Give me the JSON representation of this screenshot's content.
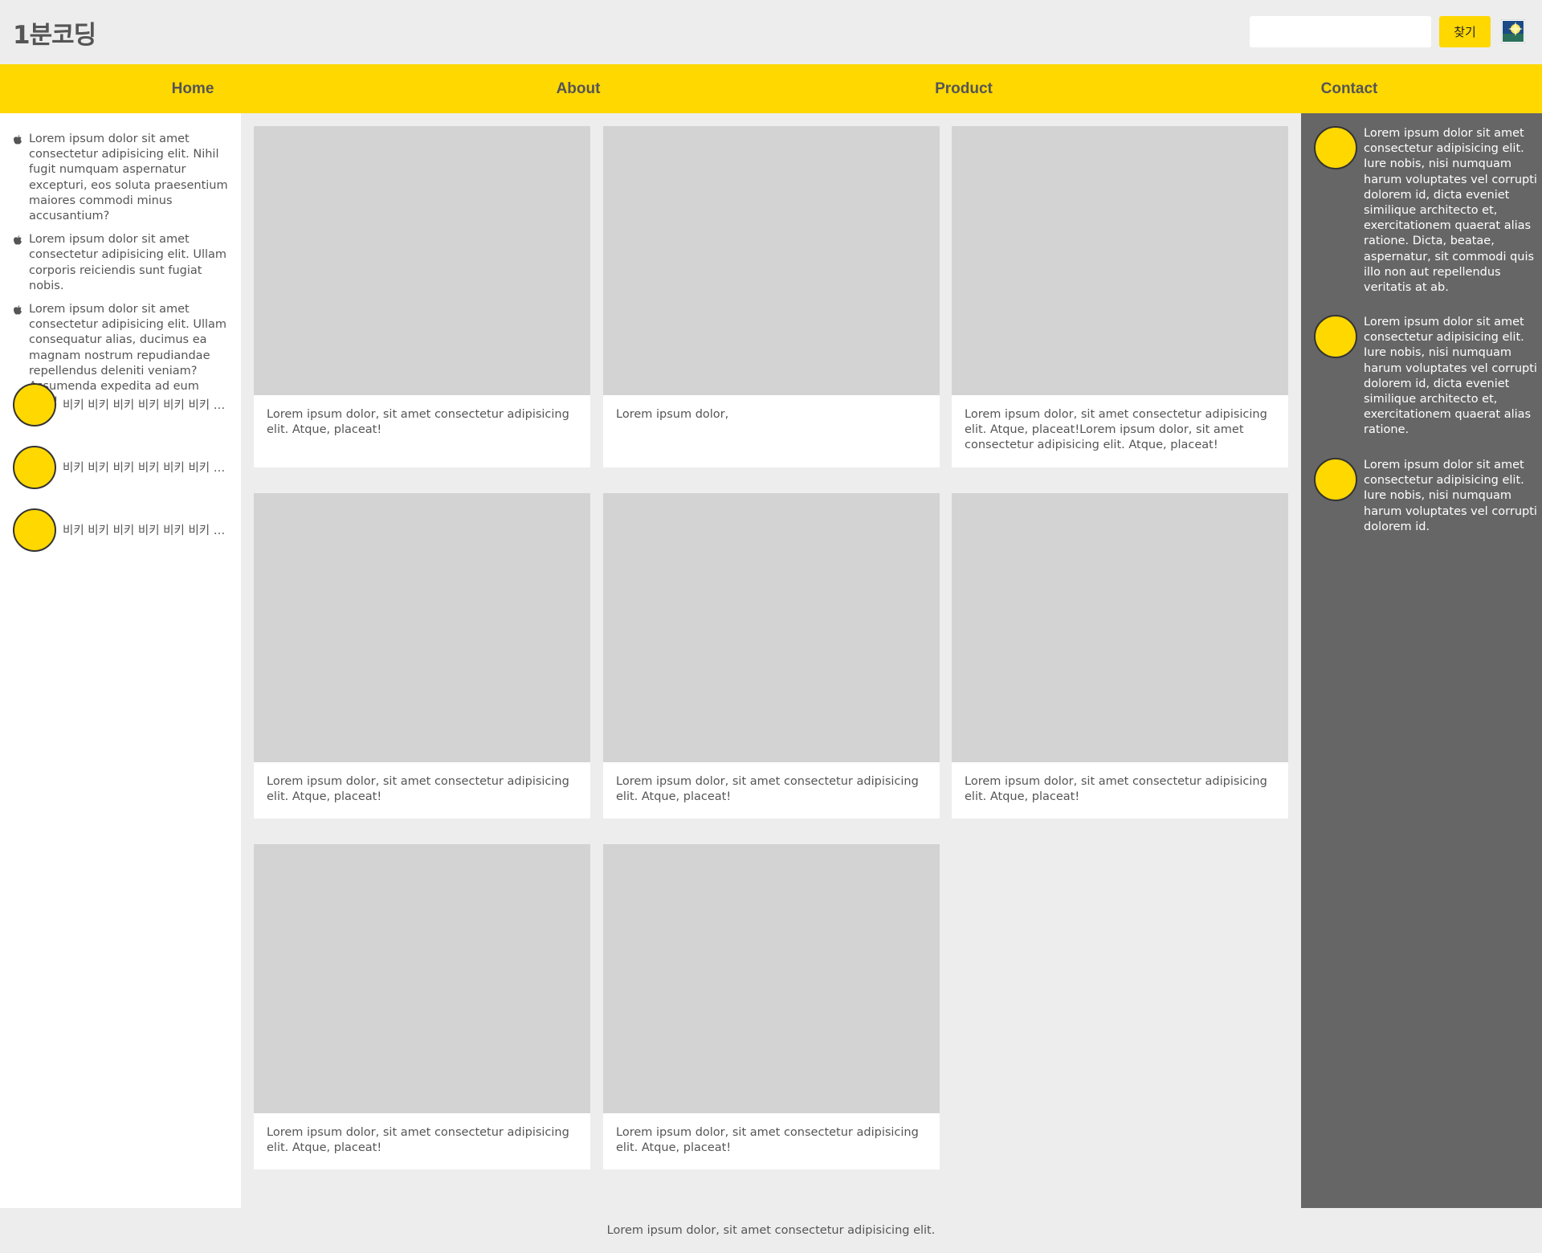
{
  "header": {
    "logo": "1분코딩",
    "search": {
      "value": "",
      "placeholder": ""
    },
    "search_button": "찾기",
    "profile_icon": "landscape-image-icon"
  },
  "nav": {
    "items": [
      {
        "label": "Home"
      },
      {
        "label": "About"
      },
      {
        "label": "Product"
      },
      {
        "label": "Contact"
      }
    ]
  },
  "left_sidebar": {
    "list_icon": "apple-icon",
    "items": [
      {
        "text": "Lorem ipsum dolor sit amet consectetur adipisicing elit. Nihil fugit numquam aspernatur excepturi, eos soluta praesentium maiores commodi minus accusantium?"
      },
      {
        "text": "Lorem ipsum dolor sit amet consectetur adipisicing elit. Ullam corporis reiciendis sunt fugiat nobis."
      },
      {
        "text": "Lorem ipsum dolor sit amet consectetur adipisicing elit. Ullam consequatur alias, ducimus ea magnam nostrum repudiandae repellendus deleniti veniam? Assumenda expedita ad eum nihil!"
      }
    ],
    "friends": [
      {
        "name": "비키 비키 비키 비키 비키 비키 비키 비키"
      },
      {
        "name": "비키 비키 비키 비키 비키 비키 비키 비키"
      },
      {
        "name": "비키 비키 비키 비키 비키 비키 비키 비키"
      }
    ]
  },
  "cards": [
    {
      "text": "Lorem ipsum dolor, sit amet consectetur adipisicing elit. Atque, placeat!"
    },
    {
      "text": "Lorem ipsum dolor,"
    },
    {
      "text": "Lorem ipsum dolor, sit amet consectetur adipisicing elit. Atque, placeat!Lorem ipsum dolor, sit amet consectetur adipisicing elit. Atque, placeat!"
    },
    {
      "text": "Lorem ipsum dolor, sit amet consectetur adipisicing elit. Atque, placeat!"
    },
    {
      "text": "Lorem ipsum dolor, sit amet consectetur adipisicing elit. Atque, placeat!"
    },
    {
      "text": "Lorem ipsum dolor, sit amet consectetur adipisicing elit. Atque, placeat!"
    },
    {
      "text": "Lorem ipsum dolor, sit amet consectetur adipisicing elit. Atque, placeat!"
    },
    {
      "text": "Lorem ipsum dolor, sit amet consectetur adipisicing elit. Atque, placeat!"
    }
  ],
  "right_sidebar": {
    "items": [
      {
        "text": "Lorem ipsum dolor sit amet consectetur adipisicing elit. Iure nobis, nisi numquam harum voluptates vel corrupti dolorem id, dicta eveniet similique architecto et, exercitationem quaerat alias ratione. Dicta, beatae, aspernatur, sit commodi quis illo non aut repellendus veritatis at ab."
      },
      {
        "text": "Lorem ipsum dolor sit amet consectetur adipisicing elit. Iure nobis, nisi numquam harum voluptates vel corrupti dolorem id, dicta eveniet similique architecto et, exercitationem quaerat alias ratione."
      },
      {
        "text": "Lorem ipsum dolor sit amet consectetur adipisicing elit. Iure nobis, nisi numquam harum voluptates vel corrupti dolorem id."
      }
    ]
  },
  "footer": {
    "text": "Lorem ipsum dolor, sit amet consectetur adipisicing elit."
  },
  "colors": {
    "accent": "#ffd800",
    "page_bg": "#ededed",
    "right_sidebar_bg": "#666666",
    "thumb": "#d3d3d3"
  }
}
